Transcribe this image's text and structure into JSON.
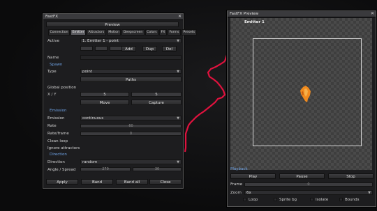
{
  "fx_window": {
    "title": "FastFX",
    "preview_label": "Preview",
    "tabs": [
      "Connection",
      "Emitter",
      "Attractors",
      "Motion",
      "Deepscreen",
      "Colors",
      "FX",
      "Forms",
      "Presets"
    ],
    "active_tab_index": 1,
    "active_label": "Active",
    "active_value": "1. Emitter 1 - point",
    "add_label": "Add",
    "dup_label": "Dup",
    "del_label": "Del",
    "name_label": "Name",
    "spawn_section": "Spawn",
    "type_label": "Type",
    "type_value": "point",
    "paths_label": "Paths",
    "global_position_label": "Global position",
    "xy_label": "X / Y",
    "x_value": "5",
    "y_value": "5",
    "move_label": "Move",
    "capture_label": "Capture",
    "emission_section": "Emission",
    "emission_label": "Emission",
    "emission_value": "continuous",
    "rate_label": "Rate",
    "rate_value": "60",
    "rate_frame_label": "Rate/frame",
    "rate_frame_value": "0",
    "clean_loop_label": "Clean loop",
    "ignore_attractors_label": "Ignore attractors",
    "direction_section": "Direction",
    "direction_label": "Direction",
    "direction_value": "random",
    "angle_spread_label": "Angle / Spread",
    "angle_value": "270",
    "spread_value": "30",
    "apply_label": "Apply",
    "band_label": "Band",
    "band_all_label": "Band all",
    "close_label": "Close"
  },
  "preview_window": {
    "title": "FastFX Preview",
    "emitter_name": "Emitter 1",
    "playback_section": "Playback",
    "play_label": "Play",
    "pause_label": "Pause",
    "stop_label": "Stop",
    "frame_label": "Frame",
    "frame_value": "0",
    "zoom_label": "Zoom",
    "zoom_value": "6x",
    "loop_label": "Loop",
    "sprite_bg_label": "Sprite bg",
    "isolate_label": "Isolate",
    "bounds_label": "Bounds"
  },
  "colors": {
    "trail": "#e0123e",
    "section": "#6fa3e6",
    "particle": "#f08a1e"
  }
}
